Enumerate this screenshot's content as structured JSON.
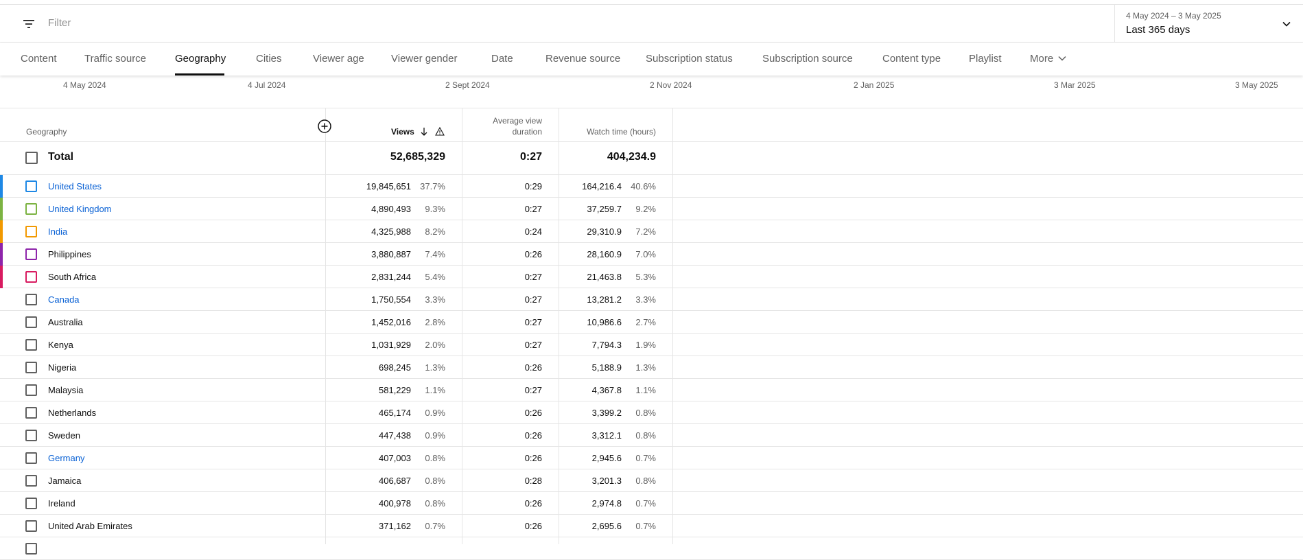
{
  "filter": {
    "placeholder": "Filter",
    "date_range": "4 May 2024 – 3 May 2025",
    "date_preset": "Last 365 days"
  },
  "tabs": [
    {
      "label": "Content",
      "active": false
    },
    {
      "label": "Traffic source",
      "active": false
    },
    {
      "label": "Geography",
      "active": true
    },
    {
      "label": "Cities",
      "active": false
    },
    {
      "label": "Viewer age",
      "active": false
    },
    {
      "label": "Viewer gender",
      "active": false
    },
    {
      "label": "Date",
      "active": false
    },
    {
      "label": "Revenue source",
      "active": false
    },
    {
      "label": "Subscription status",
      "active": false
    },
    {
      "label": "Subscription source",
      "active": false
    },
    {
      "label": "Content type",
      "active": false
    },
    {
      "label": "Playlist",
      "active": false
    }
  ],
  "more_label": "More",
  "axis_labels": [
    "4 May 2024",
    "4 Jul 2024",
    "2 Sept 2024",
    "2 Nov 2024",
    "2 Jan 2025",
    "3 Mar 2025",
    "3 May 2025"
  ],
  "table": {
    "headers": {
      "geography": "Geography",
      "views": "Views",
      "avd_line1": "Average view",
      "avd_line2": "duration",
      "watch_time": "Watch time (hours)"
    },
    "total": {
      "label": "Total",
      "views": "52,685,329",
      "avd": "0:27",
      "watch": "404,234.9"
    },
    "rows": [
      {
        "name": "United States",
        "link": true,
        "color": "#1e88e5",
        "views": "19,845,651",
        "views_pct": "37.7%",
        "avd": "0:29",
        "watch": "164,216.4",
        "watch_pct": "40.6%"
      },
      {
        "name": "United Kingdom",
        "link": true,
        "color": "#7cb342",
        "views": "4,890,493",
        "views_pct": "9.3%",
        "avd": "0:27",
        "watch": "37,259.7",
        "watch_pct": "9.2%"
      },
      {
        "name": "India",
        "link": true,
        "color": "#f29900",
        "views": "4,325,988",
        "views_pct": "8.2%",
        "avd": "0:24",
        "watch": "29,310.9",
        "watch_pct": "7.2%"
      },
      {
        "name": "Philippines",
        "link": false,
        "color": "#8e24aa",
        "views": "3,880,887",
        "views_pct": "7.4%",
        "avd": "0:26",
        "watch": "28,160.9",
        "watch_pct": "7.0%"
      },
      {
        "name": "South Africa",
        "link": false,
        "color": "#d81b60",
        "views": "2,831,244",
        "views_pct": "5.4%",
        "avd": "0:27",
        "watch": "21,463.8",
        "watch_pct": "5.3%"
      },
      {
        "name": "Canada",
        "link": true,
        "color": "",
        "views": "1,750,554",
        "views_pct": "3.3%",
        "avd": "0:27",
        "watch": "13,281.2",
        "watch_pct": "3.3%"
      },
      {
        "name": "Australia",
        "link": false,
        "color": "",
        "views": "1,452,016",
        "views_pct": "2.8%",
        "avd": "0:27",
        "watch": "10,986.6",
        "watch_pct": "2.7%"
      },
      {
        "name": "Kenya",
        "link": false,
        "color": "",
        "views": "1,031,929",
        "views_pct": "2.0%",
        "avd": "0:27",
        "watch": "7,794.3",
        "watch_pct": "1.9%"
      },
      {
        "name": "Nigeria",
        "link": false,
        "color": "",
        "views": "698,245",
        "views_pct": "1.3%",
        "avd": "0:26",
        "watch": "5,188.9",
        "watch_pct": "1.3%"
      },
      {
        "name": "Malaysia",
        "link": false,
        "color": "",
        "views": "581,229",
        "views_pct": "1.1%",
        "avd": "0:27",
        "watch": "4,367.8",
        "watch_pct": "1.1%"
      },
      {
        "name": "Netherlands",
        "link": false,
        "color": "",
        "views": "465,174",
        "views_pct": "0.9%",
        "avd": "0:26",
        "watch": "3,399.2",
        "watch_pct": "0.8%"
      },
      {
        "name": "Sweden",
        "link": false,
        "color": "",
        "views": "447,438",
        "views_pct": "0.9%",
        "avd": "0:26",
        "watch": "3,312.1",
        "watch_pct": "0.8%"
      },
      {
        "name": "Germany",
        "link": true,
        "color": "",
        "views": "407,003",
        "views_pct": "0.8%",
        "avd": "0:26",
        "watch": "2,945.6",
        "watch_pct": "0.7%"
      },
      {
        "name": "Jamaica",
        "link": false,
        "color": "",
        "views": "406,687",
        "views_pct": "0.8%",
        "avd": "0:28",
        "watch": "3,201.3",
        "watch_pct": "0.8%"
      },
      {
        "name": "Ireland",
        "link": false,
        "color": "",
        "views": "400,978",
        "views_pct": "0.8%",
        "avd": "0:26",
        "watch": "2,974.8",
        "watch_pct": "0.7%"
      },
      {
        "name": "United Arab Emirates",
        "link": false,
        "color": "",
        "views": "371,162",
        "views_pct": "0.7%",
        "avd": "0:26",
        "watch": "2,695.6",
        "watch_pct": "0.7%"
      }
    ]
  },
  "colors": {
    "link": "#065fd4",
    "text_secondary": "#606060",
    "divider": "#e5e5e5"
  },
  "icons": {
    "filter": "filter-lines-icon",
    "chevron": "chevron-down-icon",
    "add_column": "plus-circle-icon",
    "sort": "arrow-down-icon",
    "warning": "warning-triangle-icon"
  }
}
